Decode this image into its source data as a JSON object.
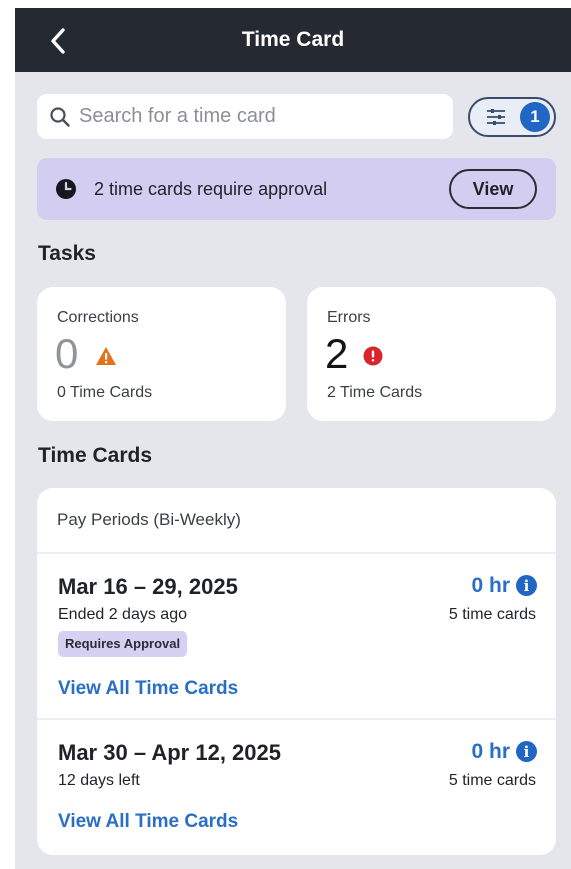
{
  "header": {
    "title": "Time Card",
    "back_icon": "chevron-left-icon"
  },
  "search": {
    "placeholder": "Search for a time card",
    "value": "",
    "icon": "search-icon"
  },
  "filter": {
    "icon": "sliders-icon",
    "count": "1"
  },
  "approval_banner": {
    "icon": "clock-icon",
    "message": "2 time cards require approval",
    "button_label": "View"
  },
  "tasks": {
    "section_title": "Tasks",
    "corrections": {
      "label": "Corrections",
      "count": "0",
      "icon": "warning-triangle-icon",
      "sub": "0 Time Cards"
    },
    "errors": {
      "label": "Errors",
      "count": "2",
      "icon": "error-circle-icon",
      "sub": "2 Time Cards"
    }
  },
  "time_cards": {
    "section_title": "Time Cards",
    "panel_heading": "Pay Periods (Bi-Weekly)",
    "periods": [
      {
        "range": "Mar 16 – 29, 2025",
        "status": "Ended 2 days ago",
        "badge": "Requires Approval",
        "hours": "0 hr",
        "count_label": "5 time cards",
        "link": "View All Time Cards"
      },
      {
        "range": "Mar 30 – Apr 12, 2025",
        "status": "12 days left",
        "hours": "0 hr",
        "count_label": "5 time cards",
        "link": "View All Time Cards"
      }
    ]
  },
  "colors": {
    "header_bg": "#252a32",
    "page_bg": "#e4e6eb",
    "banner_bg": "#d3cdf1",
    "accent_blue": "#2a6fc4",
    "warning_orange": "#e2721d",
    "error_red": "#d8262c"
  }
}
